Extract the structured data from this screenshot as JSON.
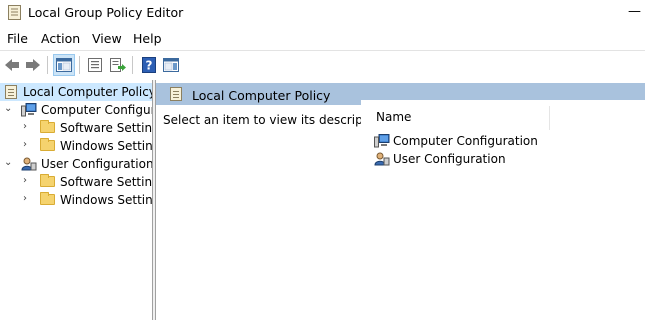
{
  "window": {
    "title": "Local Group Policy Editor",
    "minimize_glyph": "—"
  },
  "menu": [
    "File",
    "Action",
    "View",
    "Help"
  ],
  "toolbar": {
    "buttons": [
      "back-arrow-icon",
      "forward-arrow-icon",
      "show-hide-tree-icon",
      "properties-icon",
      "export-list-icon",
      "help-icon",
      "show-hide-action-pane-icon"
    ]
  },
  "tree": {
    "root": "Local Computer Policy",
    "computer": "Computer Configura",
    "computer_children": [
      "Software Settings",
      "Windows Setting"
    ],
    "user": "User Configuration",
    "user_children": [
      "Software Settings",
      "Windows Setting"
    ]
  },
  "main": {
    "header": "Local Computer Policy",
    "description": "Select an item to view its description.",
    "column_name": "Name",
    "items": [
      "Computer Configuration",
      "User Configuration"
    ]
  },
  "colors": {
    "header_band": "#a9c2dd",
    "selection": "#cce8ff"
  }
}
